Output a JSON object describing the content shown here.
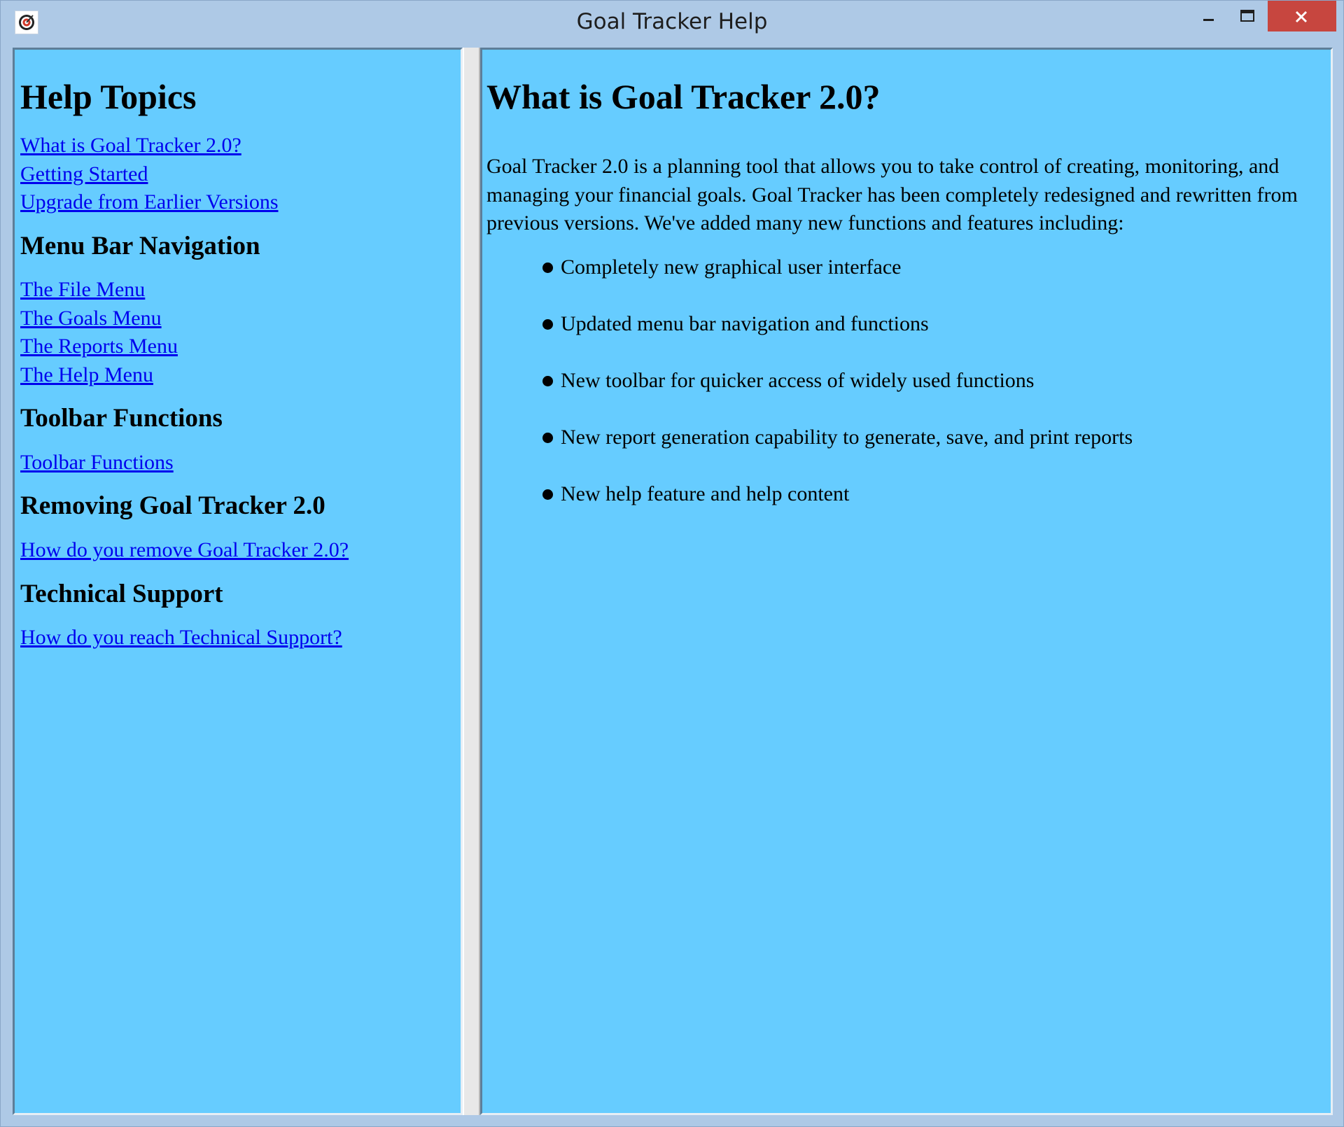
{
  "window": {
    "title": "Goal Tracker Help",
    "app_icon": "target-icon",
    "controls": [
      "minimize-icon",
      "maximize-icon",
      "close-icon"
    ]
  },
  "nav": {
    "heading": "Help Topics",
    "top_links": [
      "What is Goal Tracker 2.0?",
      "Getting Started",
      "Upgrade from Earlier Versions"
    ],
    "sections": [
      {
        "heading": "Menu Bar Navigation",
        "links": [
          "The File Menu",
          "The Goals Menu",
          "The Reports Menu",
          "The Help Menu"
        ]
      },
      {
        "heading": "Toolbar Functions",
        "links": [
          "Toolbar Functions"
        ]
      },
      {
        "heading": "Removing Goal Tracker 2.0",
        "links": [
          "How do you remove Goal Tracker 2.0?"
        ]
      },
      {
        "heading": "Technical Support",
        "links": [
          "How do you reach Technical Support?"
        ]
      }
    ]
  },
  "content": {
    "title": "What is Goal Tracker 2.0?",
    "intro": "Goal Tracker 2.0 is a planning tool that allows you to take control of creating, monitoring, and managing your financial goals. Goal Tracker has been completely redesigned and rewritten from previous versions. We've added many new functions and features including:",
    "features": [
      "Completely new graphical user interface",
      "Updated menu bar navigation and functions",
      "New toolbar for quicker access of widely used functions",
      "New report generation capability to generate, save, and print reports",
      "New help feature and help content"
    ]
  },
  "colors": {
    "pane_background": "#66ccff",
    "window_frame": "#aec9e6",
    "link": "#0000ee",
    "close_button": "#c7463f"
  }
}
